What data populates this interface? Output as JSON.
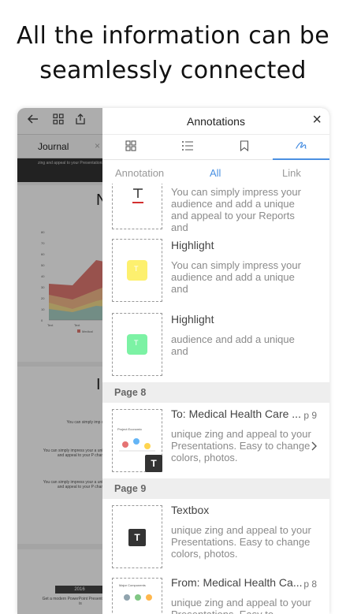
{
  "headline": {
    "line1": "All the information can be",
    "line2": "seamlessly connected"
  },
  "background": {
    "tab_label": "Journal",
    "tab_close": "×",
    "strip_text": "zing and appeal to your Presentations believe that this Template will your T... Reputation.",
    "page1_letter": "N",
    "page2_letter": "I",
    "page2_texts": [
      "You can simply imp unique zing and appea",
      "You can simply impress your a unique zing and appeal to your P chan",
      "You can simply impress your a unique zing and appeal to your P chan"
    ],
    "year": "2016",
    "page3_text": "Get a modern PowerPoint Presentation that is",
    "chart": {
      "y_ticks": [
        "0",
        "10",
        "20",
        "30",
        "40",
        "50",
        "60",
        "70",
        "80"
      ],
      "x_ticks": [
        "Text",
        "Text"
      ],
      "legend": [
        "Medical"
      ]
    }
  },
  "panel": {
    "title": "Annotations",
    "close": "×",
    "icon_tabs": [
      {
        "icon": "grid-icon"
      },
      {
        "icon": "list-icon"
      },
      {
        "icon": "bookmark-icon"
      },
      {
        "icon": "annotation-pen-icon"
      }
    ],
    "filters": [
      "Annotation",
      "All",
      "Link"
    ],
    "active_filter": "All",
    "items": [
      {
        "kind": "text-annotation",
        "title": "",
        "text": "You can simply impress your audience and add a unique and appeal to your Reports and"
      },
      {
        "kind": "highlight",
        "title": "Highlight",
        "text": "You can simply impress your audience and add a unique and",
        "color": "#fdf06e"
      },
      {
        "kind": "highlight",
        "title": "Highlight",
        "text": "audience and add a unique and",
        "color": "#7cf2a4"
      }
    ],
    "sections": [
      {
        "label": "Page 8",
        "items": [
          {
            "kind": "link",
            "title": "To: Medical Health Care ...",
            "page": "p 9",
            "text": "unique zing and appeal to your Presentations. Easy to change colors, photos.",
            "thumb_title": "Project Economic"
          }
        ]
      },
      {
        "label": "Page 9",
        "items": [
          {
            "kind": "textbox",
            "title": "Textbox",
            "text": "unique zing and appeal to your Presentations. Easy to change colors, photos."
          },
          {
            "kind": "link",
            "title": "From: Medical Health Ca...",
            "page": "p 8",
            "text": "unique zing and appeal to your Presentations. Easy to",
            "thumb_title": "Major Components"
          }
        ]
      }
    ],
    "colors": {
      "accent": "#4a90e2",
      "red_underline": "#d32f2f"
    }
  }
}
